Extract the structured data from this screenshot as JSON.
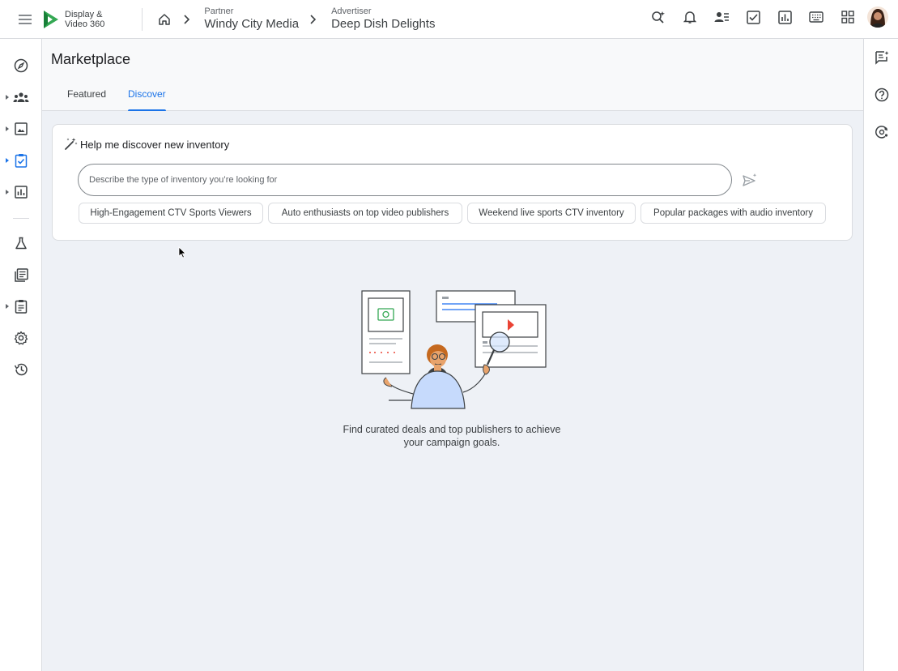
{
  "app": {
    "name_line1": "Display &",
    "name_line2": "Video 360"
  },
  "breadcrumb": {
    "partner_label": "Partner",
    "partner_value": "Windy City Media",
    "advertiser_label": "Advertiser",
    "advertiser_value": "Deep Dish Delights"
  },
  "page": {
    "title": "Marketplace",
    "tabs": [
      {
        "label": "Featured",
        "active": false
      },
      {
        "label": "Discover",
        "active": true
      }
    ]
  },
  "discover_card": {
    "title": "Help me discover new inventory",
    "search_placeholder": "Describe the type of inventory you’re looking for",
    "suggestions": [
      "High-Engagement CTV Sports Viewers",
      "Auto enthusiasts on top video publishers",
      "Weekend live sports CTV inventory",
      "Popular packages with audio inventory"
    ]
  },
  "empty_state": {
    "line1": "Find curated deals and top publishers to achieve",
    "line2": "your campaign goals."
  },
  "colors": {
    "accent": "#1a73e8",
    "brand_green": "#34a853"
  }
}
